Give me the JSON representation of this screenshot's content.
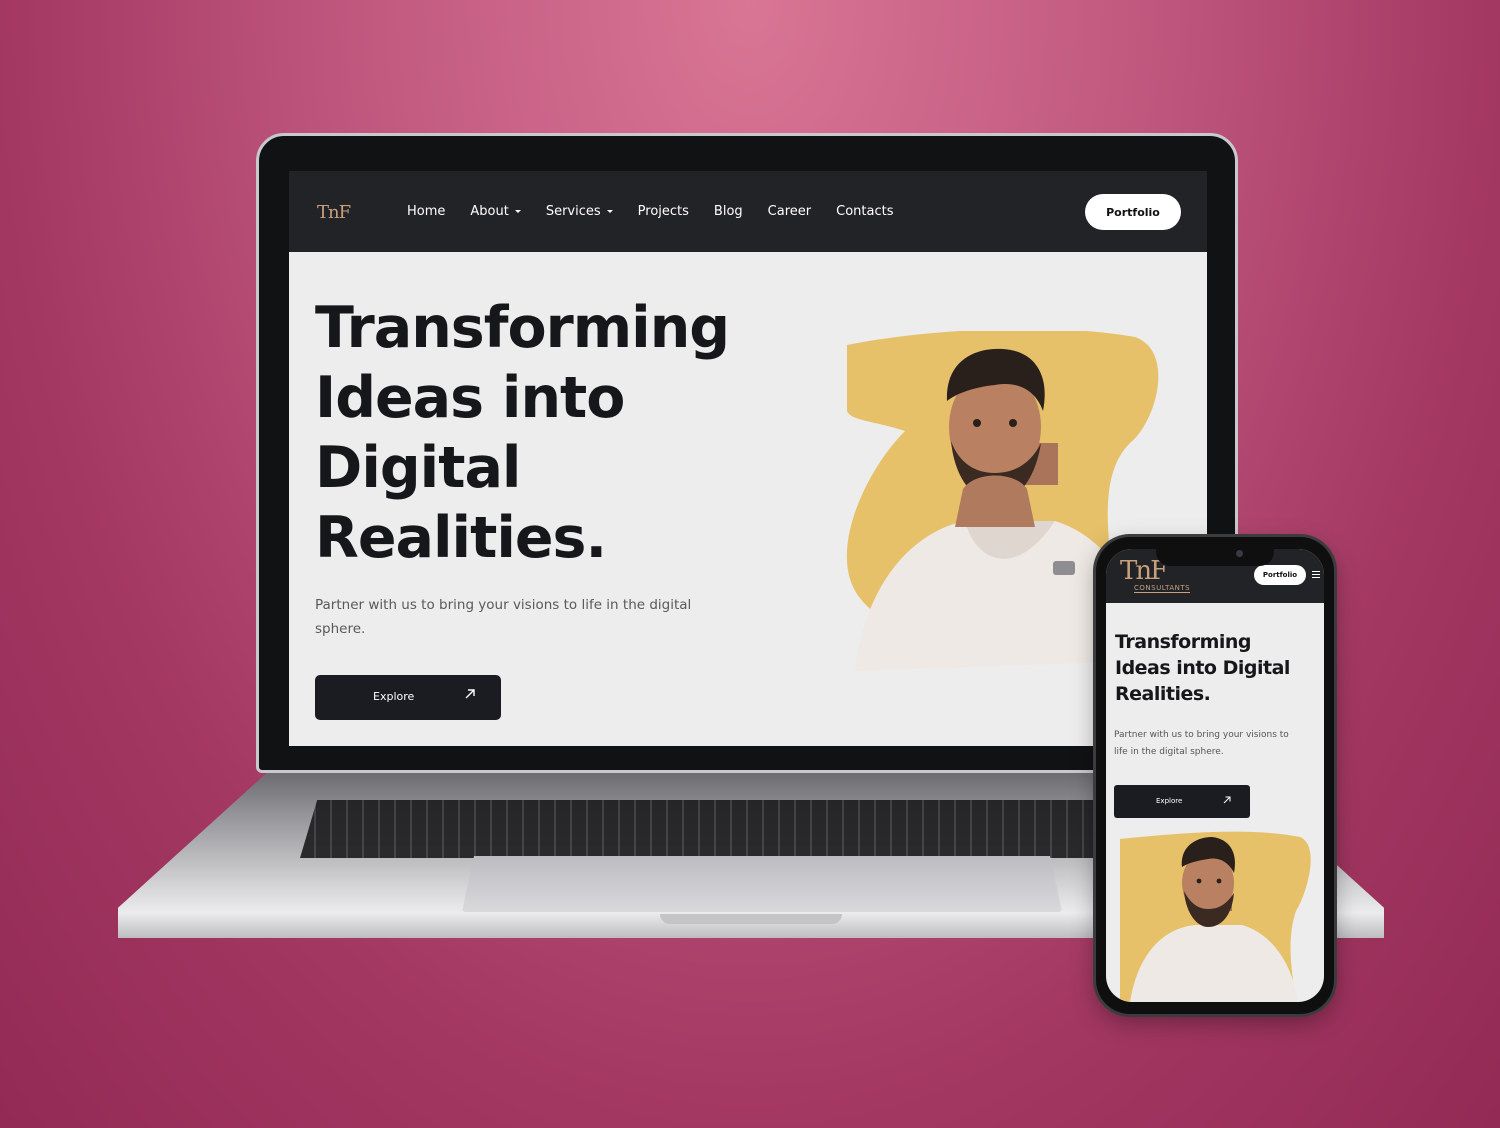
{
  "laptop": {
    "logo": "TnF",
    "nav": {
      "items": [
        {
          "label": "Home",
          "dropdown": false
        },
        {
          "label": "About",
          "dropdown": true
        },
        {
          "label": "Services",
          "dropdown": true
        },
        {
          "label": "Projects",
          "dropdown": false
        },
        {
          "label": "Blog",
          "dropdown": false
        },
        {
          "label": "Career",
          "dropdown": false
        },
        {
          "label": "Contacts",
          "dropdown": false
        }
      ],
      "portfolio_label": "Portfolio"
    },
    "hero": {
      "heading_lines": [
        "Transforming",
        "Ideas into",
        "Digital",
        "Realities."
      ],
      "subtitle_lines": [
        "Partner with us to bring your visions to life in the digital",
        "sphere."
      ],
      "button_label": "Explore",
      "button_icon": "arrow-up-right-icon"
    }
  },
  "phone": {
    "logo": "TnF",
    "logo_sub": "CONSULTANTS",
    "portfolio_label": "Portfolio",
    "menu_icon": "hamburger-icon",
    "hero": {
      "heading_lines": [
        "Transforming",
        "Ideas into Digital",
        "Realities."
      ],
      "subtitle_lines": [
        "Partner with us to bring your visions to",
        "life in the digital sphere."
      ],
      "button_label": "Explore",
      "button_icon": "arrow-up-right-icon"
    }
  },
  "colors": {
    "background": "#b34470",
    "nav_bg": "#222326",
    "accent_blob": "#e6c16a",
    "logo_gold": "#c8a07c",
    "button_dark": "#1b1c22"
  }
}
